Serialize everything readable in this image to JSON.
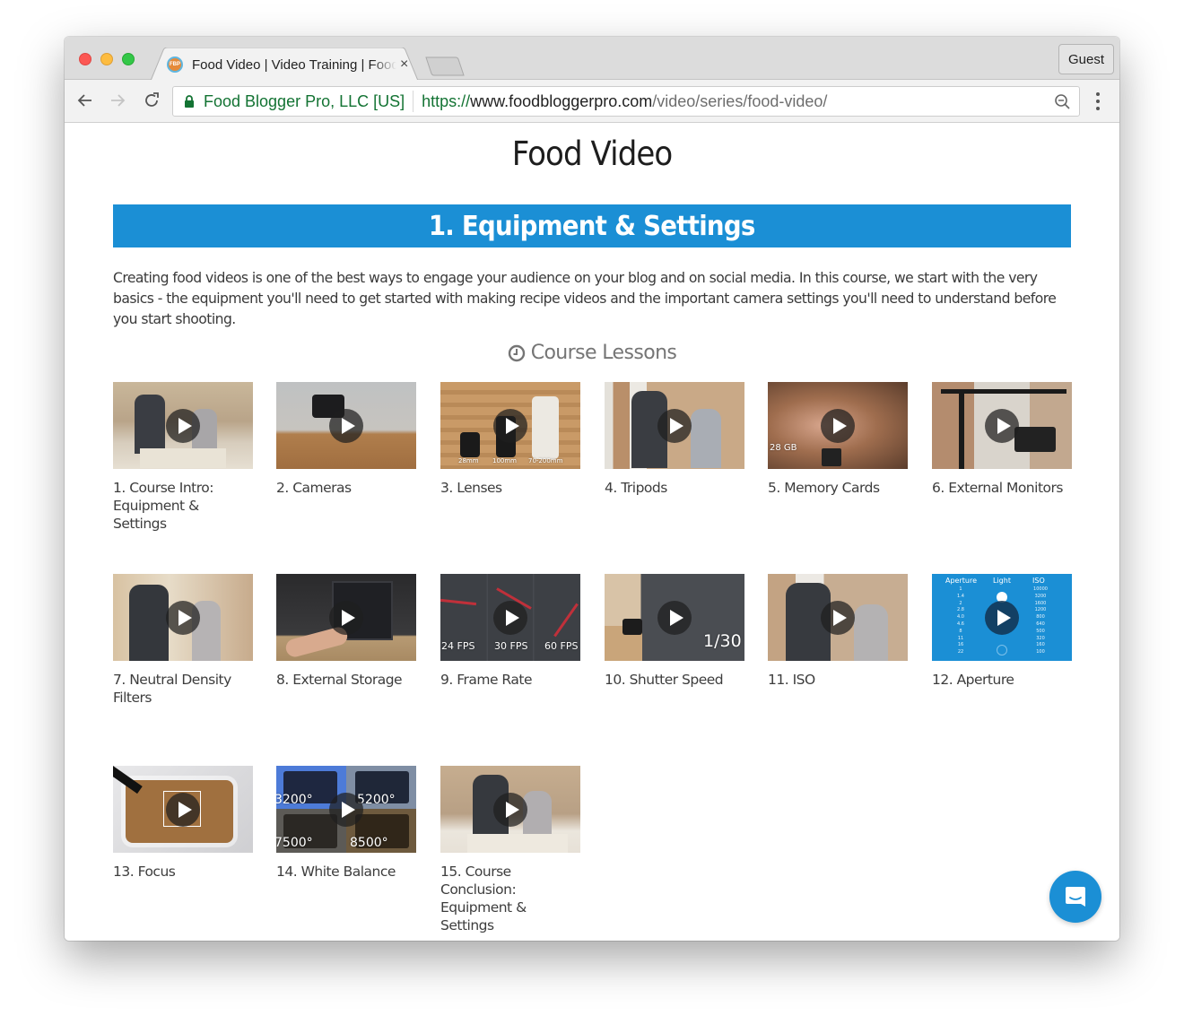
{
  "browser": {
    "tab_title": "Food Video | Video Training | Food Blogger Pro",
    "favicon_label": "FBP",
    "close_tab_glyph": "×",
    "profile_button": "Guest",
    "security_label": "Food Blogger Pro, LLC [US]",
    "url_scheme": "https://",
    "url_host": "www.foodbloggerpro.com",
    "url_path": "/video/series/food-video/"
  },
  "page": {
    "title": "Food Video",
    "section_title": "1. Equipment & Settings",
    "intro": "Creating food videos is one of the best ways to engage your audience on your blog and on social media. In this course, we start with the very basics - the equipment you'll need to get started with making recipe videos and the important camera settings you'll need to understand before you start shooting.",
    "lessons_heading": "Course Lessons",
    "accent_color": "#1b8fd5"
  },
  "lessons": [
    {
      "label": "1. Course Intro: Equipment & Settings",
      "overlay": []
    },
    {
      "label": "2. Cameras",
      "overlay": []
    },
    {
      "label": "3. Lenses",
      "overlay": [
        "28mm",
        "100mm",
        "70-200mm"
      ]
    },
    {
      "label": "4. Tripods",
      "overlay": []
    },
    {
      "label": "5. Memory Cards",
      "overlay": [
        "28 GB"
      ]
    },
    {
      "label": "6. External Monitors",
      "overlay": []
    },
    {
      "label": "7. Neutral Density Filters",
      "overlay": []
    },
    {
      "label": "8. External Storage",
      "overlay": []
    },
    {
      "label": "9. Frame Rate",
      "overlay": [
        "24 FPS",
        "30 FPS",
        "60 FPS"
      ]
    },
    {
      "label": "10. Shutter Speed",
      "overlay": [
        "1/30"
      ]
    },
    {
      "label": "11. ISO",
      "overlay": []
    },
    {
      "label": "12. Aperture",
      "overlay": [
        "Aperture",
        "Light",
        "ISO"
      ],
      "aperture_values": [
        "1",
        "1.4",
        "2",
        "2.8",
        "4.0",
        "4.6",
        "8",
        "11",
        "16",
        "22"
      ],
      "iso_values": [
        "10000",
        "3200",
        "1600",
        "1200",
        "800",
        "640",
        "500",
        "320",
        "160",
        "100"
      ]
    },
    {
      "label": "13. Focus",
      "overlay": []
    },
    {
      "label": "14. White Balance",
      "overlay": [
        "3200°",
        "5200°",
        "7500°",
        "8500°"
      ]
    },
    {
      "label": "15. Course Conclusion: Equipment & Settings",
      "overlay": []
    }
  ]
}
